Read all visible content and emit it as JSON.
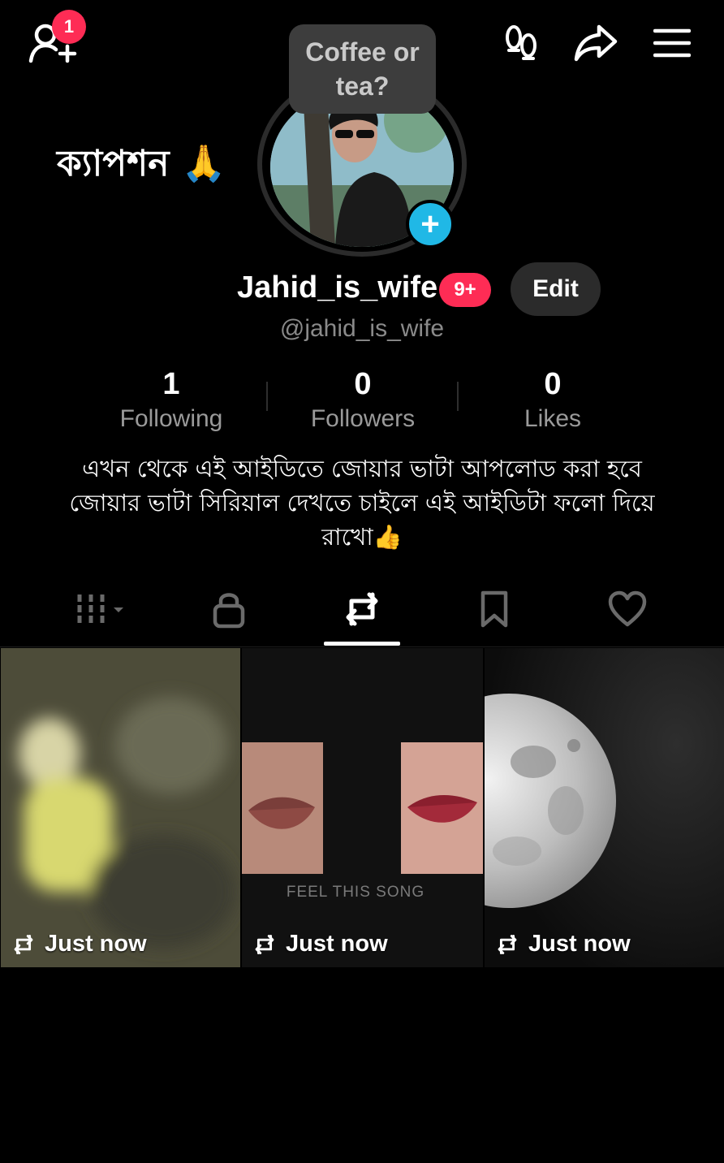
{
  "header": {
    "notification_count": "1",
    "icons": [
      "add-friend-icon",
      "footprints-icon",
      "share-icon",
      "menu-icon"
    ]
  },
  "overlay": {
    "caption": "ক্যাপশন 🙏"
  },
  "profile": {
    "note_bubble": "Coffee or tea?",
    "display_name": "Jahid_is_wife",
    "name_badge": "9+",
    "edit_label": "Edit",
    "handle": "@jahid_is_wife"
  },
  "stats": [
    {
      "value": "1",
      "label": "Following"
    },
    {
      "value": "0",
      "label": "Followers"
    },
    {
      "value": "0",
      "label": "Likes"
    }
  ],
  "bio": "এখন থেকে এই আইডিতে জোয়ার ভাটা আপলোড করা হবে জোয়ার ভাটা সিরিয়াল দেখতে চাইলে এই আইডিটা ফলো দিয়ে রাখো👍",
  "tabs": [
    {
      "icon": "grid-icon",
      "selected": false
    },
    {
      "icon": "lock-icon",
      "selected": false
    },
    {
      "icon": "repost-icon",
      "selected": true
    },
    {
      "icon": "bookmark-icon",
      "selected": false
    },
    {
      "icon": "heart-icon",
      "selected": false
    }
  ],
  "videos": [
    {
      "timestamp": "Just now",
      "overlay_text": ""
    },
    {
      "timestamp": "Just now",
      "overlay_text": "FEEL THIS SONG"
    },
    {
      "timestamp": "Just now",
      "overlay_text": ""
    }
  ],
  "colors": {
    "accent_red": "#fe2c55",
    "accent_blue": "#20b8e6",
    "background": "#000000"
  }
}
